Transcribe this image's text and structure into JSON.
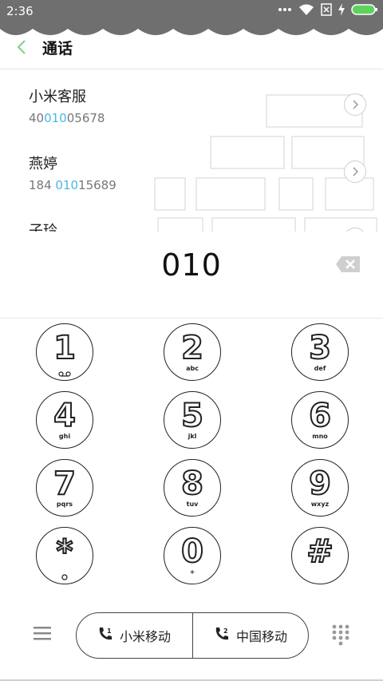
{
  "status": {
    "time": "2:36"
  },
  "header": {
    "title": "通话"
  },
  "contacts": [
    {
      "name": "小米客服",
      "number_pre": "40",
      "number_match": "010",
      "number_post": "05678"
    },
    {
      "name": "燕婷",
      "number_pre": "184 ",
      "number_match": "010",
      "number_post": "15689"
    },
    {
      "name": "子玲",
      "number_pre": "",
      "number_match": "",
      "number_post": ""
    }
  ],
  "dialer": {
    "input": "010",
    "keys": [
      {
        "digit": "1",
        "sub": ""
      },
      {
        "digit": "2",
        "sub": "abc"
      },
      {
        "digit": "3",
        "sub": "def"
      },
      {
        "digit": "4",
        "sub": "ghi"
      },
      {
        "digit": "5",
        "sub": "jkl"
      },
      {
        "digit": "6",
        "sub": "mno"
      },
      {
        "digit": "7",
        "sub": "pqrs"
      },
      {
        "digit": "8",
        "sub": "tuv"
      },
      {
        "digit": "9",
        "sub": "wxyz"
      },
      {
        "digit": "*",
        "sub": ""
      },
      {
        "digit": "0",
        "sub": "+"
      },
      {
        "digit": "#",
        "sub": ""
      }
    ]
  },
  "bottom": {
    "sim1_label": "小米移动",
    "sim2_label": "中国移动",
    "sim1_index": "1",
    "sim2_index": "2"
  },
  "icons": {
    "back": "chevron-left-icon",
    "backspace": "backspace-icon",
    "menu": "menu-icon",
    "keypad": "keypad-icon"
  },
  "colors": {
    "statusbar": "#6f6f6f",
    "accent_back": "#7ed17e",
    "match_highlight": "#49b8e3"
  }
}
